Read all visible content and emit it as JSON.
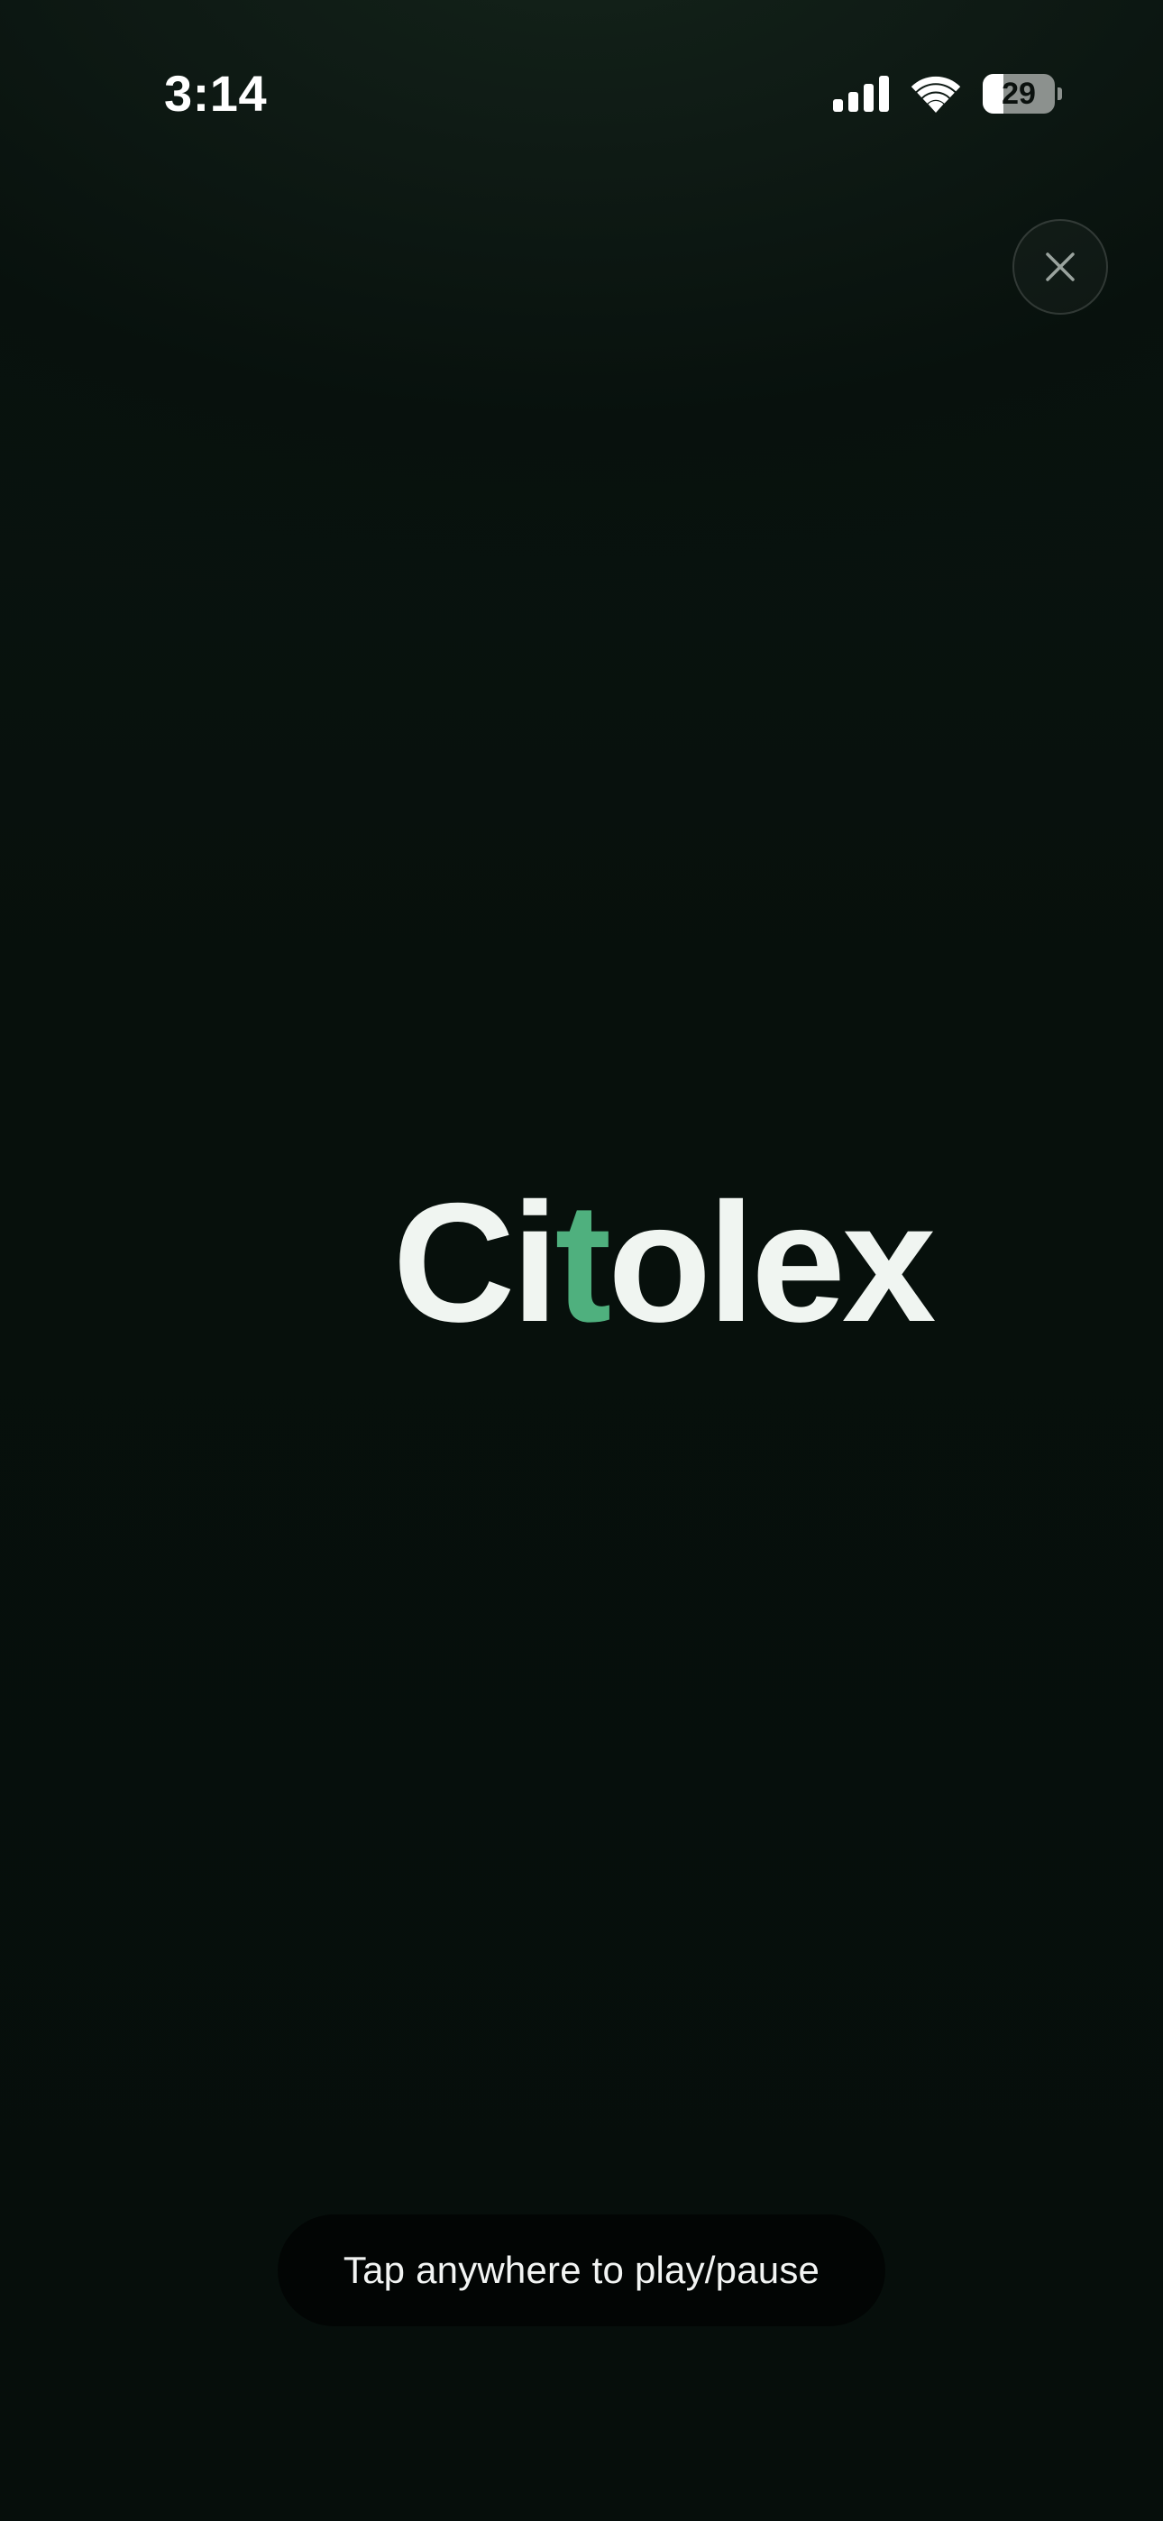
{
  "status_bar": {
    "time": "3:14",
    "battery_level": "29",
    "battery_fraction": 0.29,
    "icons": [
      "cellular-signal-icon",
      "wifi-icon",
      "battery-icon"
    ]
  },
  "close_button": {
    "icon": "close-icon"
  },
  "logo": {
    "part1": "Ci",
    "accent": "t",
    "part2": "olex",
    "accent_color": "#4fb07e",
    "text_color": "#f0f5f1"
  },
  "hint": {
    "text": "Tap anywhere to play/pause"
  },
  "colors": {
    "background": "#060e0b",
    "top_glow": "#14241a"
  }
}
